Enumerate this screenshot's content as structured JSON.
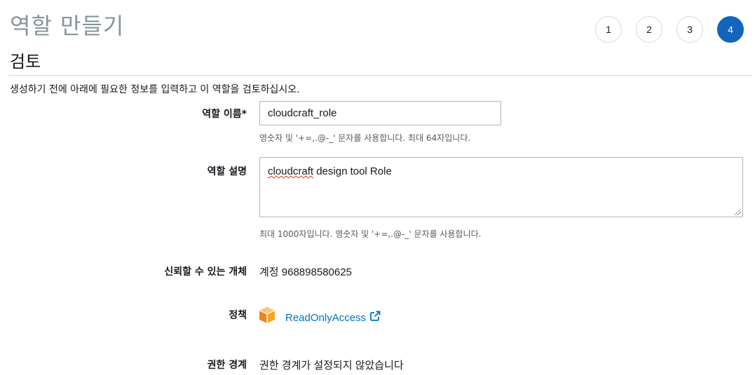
{
  "page": {
    "title": "역할 만들기"
  },
  "steps": [
    "1",
    "2",
    "3",
    "4"
  ],
  "active_step": "4",
  "section": {
    "title": "검토",
    "intro": "생성하기 전에 아래에 필요한 정보를 입력하고 이 역할을 검토하십시오."
  },
  "form": {
    "role_name": {
      "label": "역할 이름*",
      "value": "cloudcraft_role",
      "hint": "영숫자 및 '+=,.@-_' 문자를 사용합니다. 최대 64자입니다."
    },
    "role_description": {
      "label": "역할 설명",
      "value_misspelled": "cloudcraft",
      "value_rest": " design tool Role",
      "hint": "최대 1000자입니다. 영숫자 및 '+=,.@-_' 문자를 사용합니다."
    },
    "trusted_entity": {
      "label": "신뢰할 수 있는 개체",
      "value": "계정 968898580625"
    },
    "policy": {
      "label": "정책",
      "link_text": "ReadOnlyAccess",
      "icon": "aws-policy-box-icon",
      "icon_color": "#f7a41d"
    },
    "permissions_boundary": {
      "label": "권한 경계",
      "value": "권한 경계가 설정되지 않았습니다"
    }
  },
  "colors": {
    "accent": "#1166bb",
    "link": "#0073bb",
    "muted_title": "#879596"
  }
}
